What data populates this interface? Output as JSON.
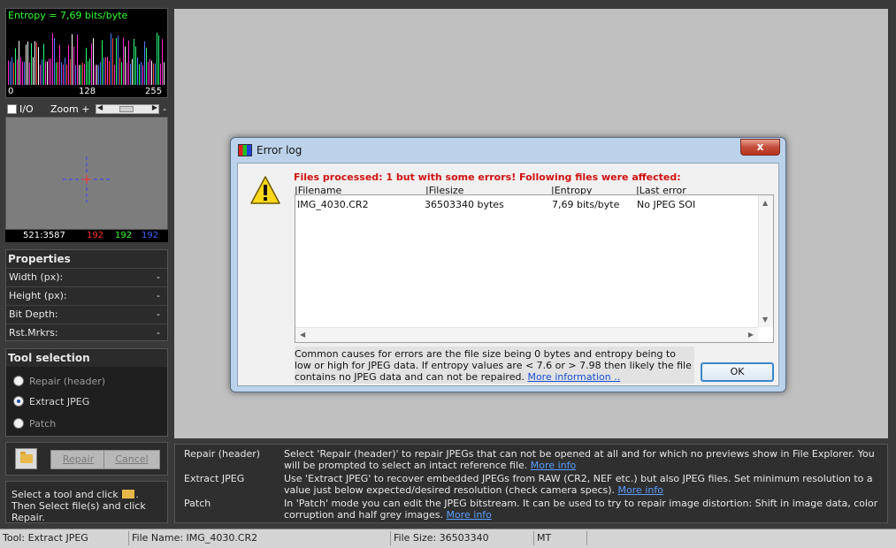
{
  "entropy": {
    "title": "Entropy = 7,69 bits/byte",
    "ticks": [
      "0",
      "128",
      "255"
    ],
    "bar_colors": [
      "#ff2ad4",
      "#ffffff",
      "#2aff7a",
      "#4a7dff",
      "#ff4a4a",
      "#ff2ad4"
    ]
  },
  "viewer": {
    "io_label": "I/O",
    "zoom_label": "Zoom +",
    "zoom_minus": "-",
    "coords": "521:3587",
    "red": "192",
    "green": "192",
    "blue": "192"
  },
  "properties": {
    "title": "Properties",
    "rows": [
      {
        "label": "Width (px):",
        "value": "-"
      },
      {
        "label": "Height (px):",
        "value": "-"
      },
      {
        "label": "Bit Depth:",
        "value": "-"
      },
      {
        "label": "Rst.Mrkrs:",
        "value": "-"
      }
    ]
  },
  "tool_selection": {
    "title": "Tool selection",
    "options": [
      {
        "label": "Repair (header)",
        "selected": false
      },
      {
        "label": "Extract JPEG",
        "selected": true
      },
      {
        "label": "Patch",
        "selected": false
      }
    ]
  },
  "actions": {
    "repair_label": "Repair",
    "cancel_label": "Cancel",
    "hint_pre": "Select a tool and click",
    "hint_post": ". Then Select file(s) and click Repair."
  },
  "dialog": {
    "title": "Error log",
    "close_label": "x",
    "message": "Files processed: 1 but with some errors! Following files were affected:",
    "columns": [
      "|Filename",
      "|Filesize",
      "|Entropy",
      "|Last error"
    ],
    "rows": [
      {
        "filename": "IMG_4030.CR2",
        "filesize": "36503340 bytes",
        "entropy": "7,69 bits/byte",
        "last_error": "No JPEG SOI"
      }
    ],
    "info_text": "Common causes for errors are the file size being 0 bytes and entropy being to low or high for JPEG data. If entropy values are < 7.6 or > 7.98 then likely the file contains no JPEG data and can not be repaired.",
    "info_link": "More information ..",
    "ok_label": "OK"
  },
  "help": [
    {
      "title": "Repair (header)",
      "text": "Select 'Repair (header)' to repair JPEGs that can not be opened at all and for which no previews show in File Explorer. You will be prompted to select an intact reference file.",
      "link": "More info"
    },
    {
      "title": "Extract JPEG",
      "text": "Use 'Extract JPEG' to recover embedded JPEGs from RAW (CR2, NEF etc.) but also JPEG files. Set minimum resolution to a value just below expected/desired resolution (check camera specs).",
      "link": "More info"
    },
    {
      "title": "Patch",
      "text": "In 'Patch' mode you can edit the JPEG bitstream. It can be used to try to repair image distortion: Shift in image data, color corruption and half grey images.",
      "link": "More info"
    }
  ],
  "status": {
    "tool": "Tool: Extract JPEG",
    "file_name": "File Name: IMG_4030.CR2",
    "file_size": "File Size: 36503340",
    "mode": "MT"
  },
  "colors": {
    "entropy_title": "#2dff2d",
    "error_text": "#d01010",
    "link": "#1a4fd0",
    "help_link": "#5b9dff"
  },
  "icons": [
    "folder-icon",
    "warning-icon",
    "close-icon",
    "crosshair-icon",
    "error-log-icon",
    "scroll-arrow-icon"
  ]
}
